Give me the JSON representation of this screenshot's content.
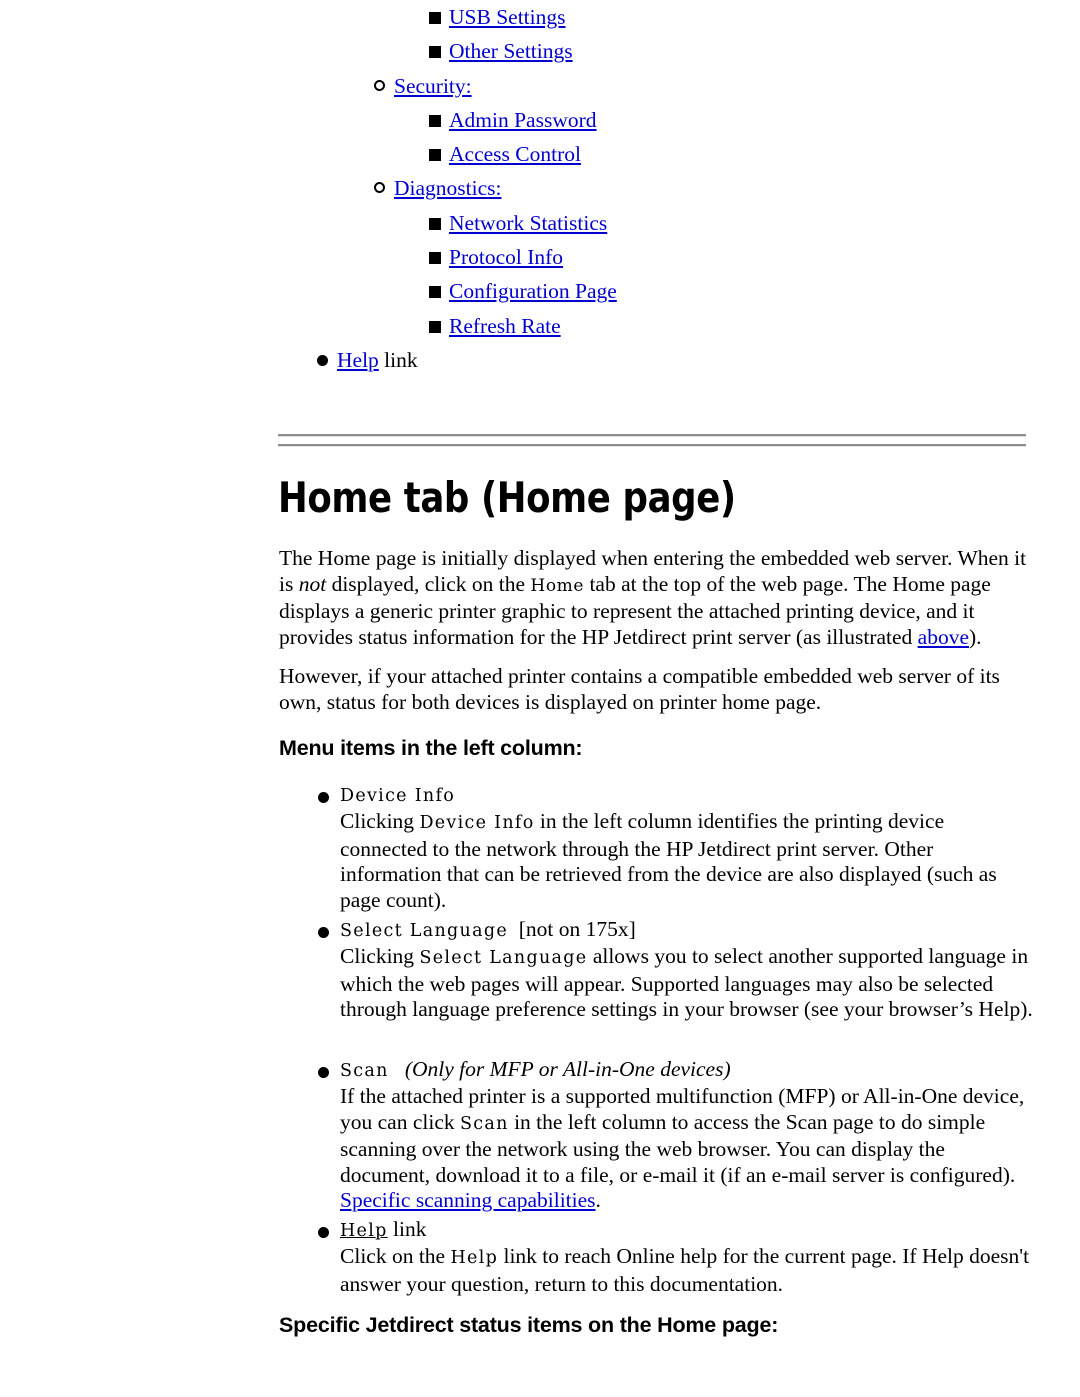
{
  "nav_list": [
    {
      "level": "square",
      "label": "USB Settings",
      "kind": "link"
    },
    {
      "level": "square",
      "label": "Other Settings",
      "kind": "link"
    },
    {
      "level": "circle",
      "label": "Security:",
      "kind": "link"
    },
    {
      "level": "square",
      "label": "Admin Password",
      "kind": "link"
    },
    {
      "level": "square",
      "label": "Access Control",
      "kind": "link"
    },
    {
      "level": "circle",
      "label": "Diagnostics:",
      "kind": "link"
    },
    {
      "level": "square",
      "label": "Network Statistics",
      "kind": "link"
    },
    {
      "level": "square",
      "label": "Protocol Info",
      "kind": "link"
    },
    {
      "level": "square",
      "label": "Configuration Page",
      "kind": "link"
    },
    {
      "level": "square",
      "label": "Refresh Rate",
      "kind": "link"
    },
    {
      "level": "disc",
      "label": "Help",
      "kind": "link",
      "suffix": " link"
    }
  ],
  "heading": "Home tab (Home page)",
  "paragraphs": {
    "p1_a": "The Home page is initially displayed when entering the embedded web server. When it is ",
    "p1_not": "not",
    "p1_b": " displayed, click on the ",
    "p1_home_code": "Home",
    "p1_c": " tab at the top of the web page. The Home page displays a generic printer graphic to represent the attached printing device, and it provides status information for the HP Jetdirect print server (as illustrated ",
    "p1_link": "above",
    "p1_d": ").",
    "p2": "However, if your attached printer contains a compatible embedded web server of its own, status for both devices is displayed on printer home page."
  },
  "subheading_menu_items": "Menu items in the left column:",
  "subheading_status_items": "Specific Jetdirect status items on the Home page:",
  "sections": {
    "device_info": {
      "term": "Device Info",
      "body_a": "Clicking ",
      "body_term": "Device Info",
      "body_b": " in the left column identifies the printing device connected to the network through the HP Jetdirect print server. Other information that can be retrieved from the device are also displayed (such as page count)."
    },
    "select_language": {
      "term": "Select Language",
      "note": "[not on 175x]",
      "body_a": "Clicking ",
      "body_term": "Select Language",
      "body_b": " allows you to select another supported language in which the web pages will appear. Supported languages may also be selected through language preference settings in your browser (see your browser’s Help)."
    },
    "scan": {
      "term": "Scan",
      "note": "(Only for MFP or All-in-One devices)",
      "body_a": "If the attached printer is a supported multifunction (MFP) or All-in-One device, you can click ",
      "body_term": "Scan",
      "body_b": " in the left column to access the Scan page to do simple scanning over the network using the web browser. You can display the document, download it to a file, or e-mail it (if an e-mail server is configured). ",
      "body_link": "Specific scanning capabilities",
      "body_c": "."
    },
    "help": {
      "term": "Help",
      "suffix": " link",
      "body_a": "Click on the ",
      "body_term": "Help",
      "body_b": " link to reach Online help for the current page. If Help doesn't answer your question, return to this documentation."
    }
  },
  "colors": {
    "link": "#0000d0",
    "text": "#000000",
    "rule": "#8c8c8c",
    "background": "#ffffff"
  }
}
